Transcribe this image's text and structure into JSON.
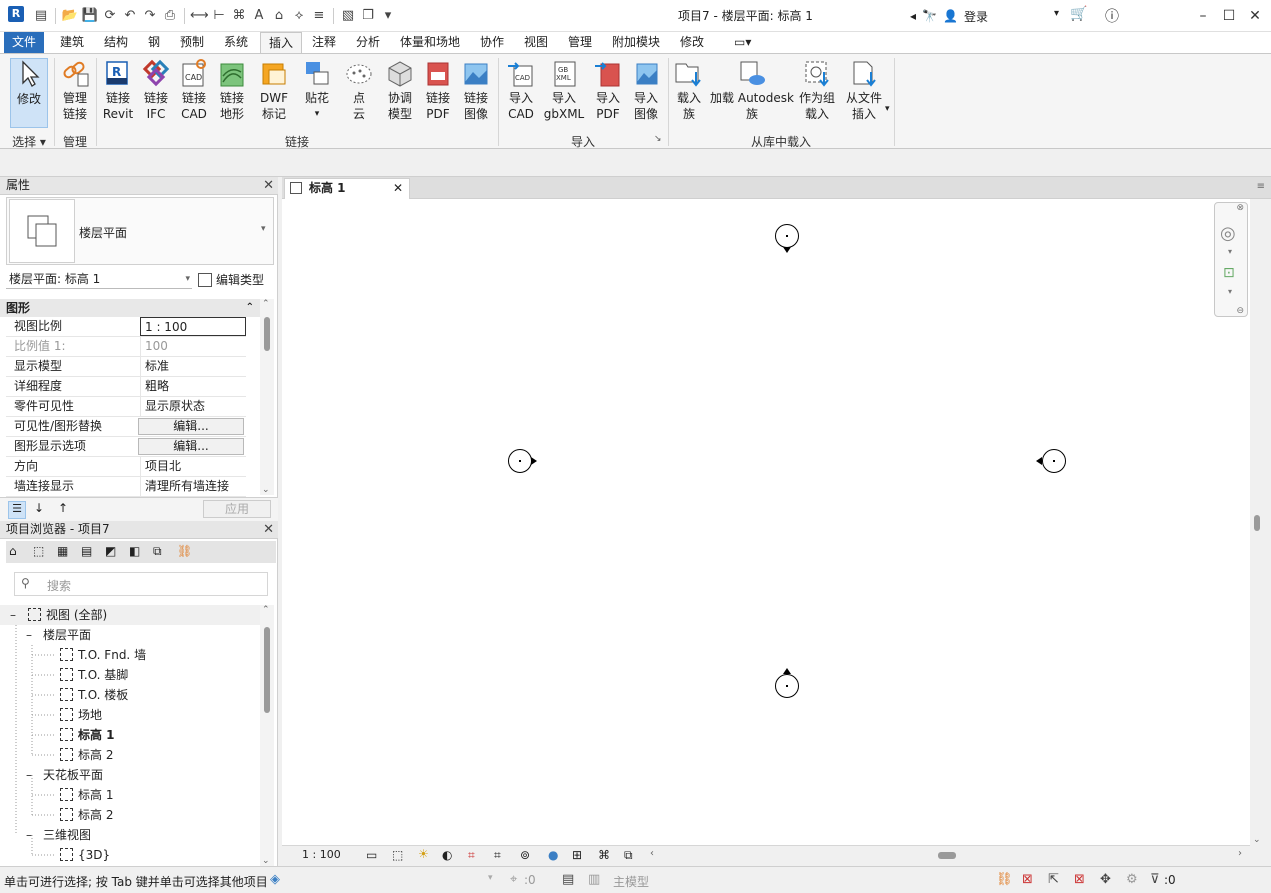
{
  "app": {
    "logo": "R",
    "window_title": "项目7 - 楼层平面: 标高 1",
    "login": "登录"
  },
  "ribbon_tabs": [
    "文件",
    "建筑",
    "结构",
    "钢",
    "预制",
    "系统",
    "插入",
    "注释",
    "分析",
    "体量和场地",
    "协作",
    "视图",
    "管理",
    "附加模块",
    "修改"
  ],
  "active_tab": "插入",
  "ribbon": {
    "select": {
      "label": "修改",
      "group": "选择"
    },
    "manage": {
      "label1": "管理",
      "label2": "链接",
      "group": "管理"
    },
    "link_buttons": [
      {
        "l1": "链接",
        "l2": "Revit"
      },
      {
        "l1": "链接",
        "l2": "IFC"
      },
      {
        "l1": "链接",
        "l2": "CAD"
      },
      {
        "l1": "链接",
        "l2": "地形"
      },
      {
        "l1": "DWF",
        "l2": "标记"
      },
      {
        "l1": "贴花",
        "l2": ""
      },
      {
        "l1": "点",
        "l2": "云"
      },
      {
        "l1": "协调",
        "l2": "模型"
      },
      {
        "l1": "链接",
        "l2": "PDF"
      },
      {
        "l1": "链接",
        "l2": "图像"
      }
    ],
    "link_group": "链接",
    "import_buttons": [
      {
        "l1": "导入",
        "l2": "CAD"
      },
      {
        "l1": "导入",
        "l2": "gbXML"
      },
      {
        "l1": "导入",
        "l2": "PDF"
      },
      {
        "l1": "导入",
        "l2": "图像"
      }
    ],
    "import_group": "导入",
    "library_buttons": [
      {
        "l1": "载入",
        "l2": "族"
      },
      {
        "l1": "加载 Autodesk",
        "l2": "族"
      },
      {
        "l1": "作为组",
        "l2": "载入"
      },
      {
        "l1": "从文件",
        "l2": "插入"
      }
    ],
    "library_group": "从库中载入"
  },
  "properties": {
    "title": "属性",
    "type_name": "楼层平面",
    "selector": "楼层平面: 标高 1",
    "edit_type": "编辑类型",
    "section": "图形",
    "rows": [
      {
        "name": "视图比例",
        "value": "1 : 100"
      },
      {
        "name": "比例值 1:",
        "value": "100"
      },
      {
        "name": "显示模型",
        "value": "标准"
      },
      {
        "name": "详细程度",
        "value": "粗略"
      },
      {
        "name": "零件可见性",
        "value": "显示原状态"
      },
      {
        "name": "可见性/图形替换",
        "value": "编辑..."
      },
      {
        "name": "图形显示选项",
        "value": "编辑..."
      },
      {
        "name": "方向",
        "value": "项目北"
      },
      {
        "name": "墙连接显示",
        "value": "清理所有墙连接"
      }
    ],
    "apply": "应用"
  },
  "browser": {
    "title": "项目浏览器 - 项目7",
    "search_placeholder": "搜索",
    "root": "视图 (全部)",
    "groups": [
      {
        "name": "楼层平面",
        "items": [
          "T.O. Fnd. 墙",
          "T.O. 基脚",
          "T.O. 楼板",
          "场地",
          "标高 1",
          "标高 2"
        ]
      },
      {
        "name": "天花板平面",
        "items": [
          "标高 1",
          "标高 2"
        ]
      },
      {
        "name": "三维视图",
        "items": [
          "{3D}"
        ]
      }
    ]
  },
  "view": {
    "tab": "标高 1",
    "scale": "1 : 100"
  },
  "status": {
    "text": "单击可进行选择; 按 Tab 键并单击可选择其他项目",
    "coord": ":0",
    "model": "主模型",
    "filter": ":0"
  }
}
